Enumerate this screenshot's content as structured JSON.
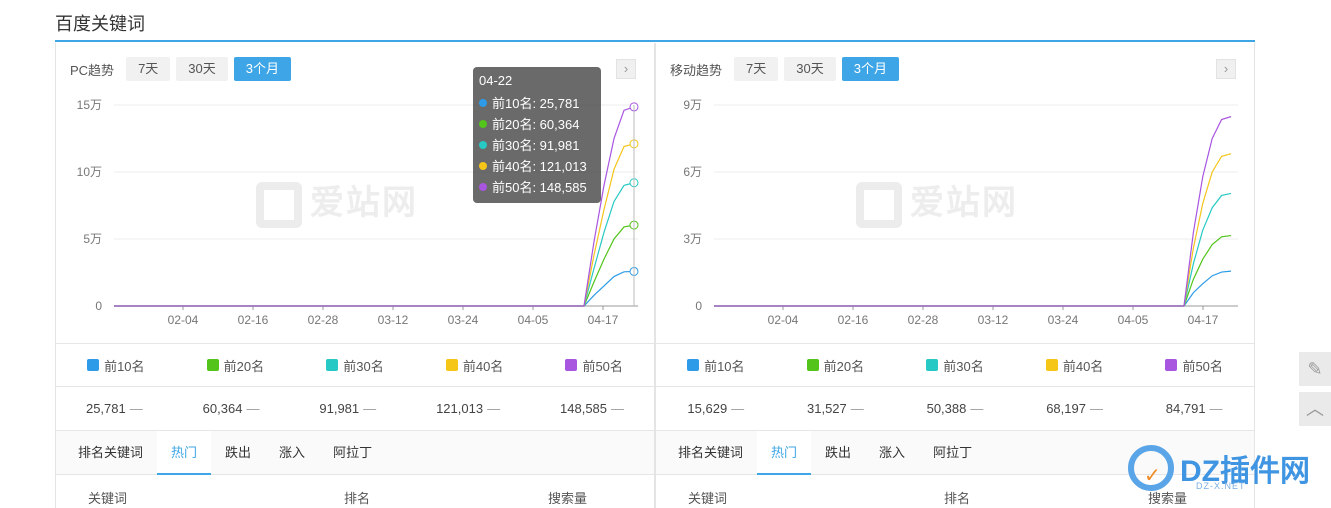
{
  "section_title": "百度关键词",
  "panels": [
    {
      "trend_label": "PC趋势",
      "ranges": [
        "7天",
        "30天",
        "3个月"
      ],
      "active_range": "3个月",
      "y_ticks": [
        "15万",
        "10万",
        "5万",
        "0"
      ],
      "x_ticks": [
        "02-04",
        "02-16",
        "02-28",
        "03-12",
        "03-24",
        "04-05",
        "04-17"
      ],
      "legend": [
        "前10名",
        "前20名",
        "前30名",
        "前40名",
        "前50名"
      ],
      "values": [
        "25,781",
        "60,364",
        "91,981",
        "121,013",
        "148,585"
      ],
      "tabs": [
        "排名关键词",
        "热门",
        "跌出",
        "涨入",
        "阿拉丁"
      ],
      "active_tab": "热门",
      "columns": [
        "关键词",
        "排名",
        "搜索量"
      ]
    },
    {
      "trend_label": "移动趋势",
      "ranges": [
        "7天",
        "30天",
        "3个月"
      ],
      "active_range": "3个月",
      "y_ticks": [
        "9万",
        "6万",
        "3万",
        "0"
      ],
      "x_ticks": [
        "02-04",
        "02-16",
        "02-28",
        "03-12",
        "03-24",
        "04-05",
        "04-17"
      ],
      "legend": [
        "前10名",
        "前20名",
        "前30名",
        "前40名",
        "前50名"
      ],
      "values": [
        "15,629",
        "31,527",
        "50,388",
        "68,197",
        "84,791"
      ],
      "tabs": [
        "排名关键词",
        "热门",
        "跌出",
        "涨入",
        "阿拉丁"
      ],
      "active_tab": "热门",
      "columns": [
        "关键词",
        "排名",
        "搜索量"
      ]
    }
  ],
  "watermark": "爱站网",
  "tooltip": {
    "date": "04-22",
    "rows": [
      {
        "label": "前10名: 25,781",
        "color": "#2d9be8"
      },
      {
        "label": "前20名: 60,364",
        "color": "#52c41a"
      },
      {
        "label": "前30名: 91,981",
        "color": "#26c9c3"
      },
      {
        "label": "前40名: 121,013",
        "color": "#f5c518"
      },
      {
        "label": "前50名: 148,585",
        "color": "#a855e0"
      }
    ]
  },
  "series_colors": [
    "#2d9be8",
    "#52c41a",
    "#26c9c3",
    "#f5c518",
    "#a855e0"
  ],
  "dz_logo": {
    "text": "DZ插件网",
    "sub": "DZ-X.NET"
  },
  "chart_data": [
    {
      "type": "line",
      "ylim": [
        0,
        150000
      ],
      "x": [
        "04-17",
        "04-18",
        "04-19",
        "04-20",
        "04-21",
        "04-22"
      ],
      "series": [
        {
          "name": "前10名",
          "values": [
            0,
            8000,
            15000,
            22000,
            25500,
            25781
          ]
        },
        {
          "name": "前20名",
          "values": [
            0,
            18000,
            35000,
            50000,
            59000,
            60364
          ]
        },
        {
          "name": "前30名",
          "values": [
            0,
            28000,
            55000,
            78000,
            90000,
            91981
          ]
        },
        {
          "name": "前40名",
          "values": [
            0,
            38000,
            72000,
            102000,
            119000,
            121013
          ]
        },
        {
          "name": "前50名",
          "values": [
            0,
            48000,
            90000,
            125000,
            146000,
            148585
          ]
        }
      ]
    },
    {
      "type": "line",
      "ylim": [
        0,
        90000
      ],
      "x": [
        "04-17",
        "04-18",
        "04-19",
        "04-20",
        "04-21",
        "04-22"
      ],
      "series": [
        {
          "name": "前10名",
          "values": [
            0,
            6000,
            10000,
            13500,
            15200,
            15629
          ]
        },
        {
          "name": "前20名",
          "values": [
            0,
            12000,
            21000,
            27500,
            31000,
            31527
          ]
        },
        {
          "name": "前30名",
          "values": [
            0,
            19000,
            34000,
            44000,
            49500,
            50388
          ]
        },
        {
          "name": "前40名",
          "values": [
            0,
            26000,
            46000,
            60000,
            67000,
            68197
          ]
        },
        {
          "name": "前50名",
          "values": [
            0,
            33000,
            58000,
            75000,
            83500,
            84791
          ]
        }
      ]
    }
  ]
}
